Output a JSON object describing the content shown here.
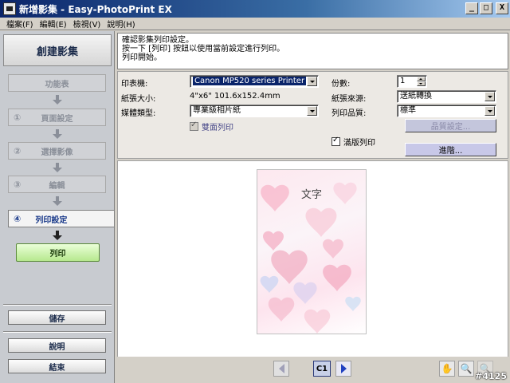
{
  "window": {
    "title": "新增影集 - Easy-PhotoPrint EX",
    "minimize": "_",
    "maximize": "□",
    "close": "X"
  },
  "menu": [
    "檔案(F)",
    "編輯(E)",
    "檢視(V)",
    "說明(H)"
  ],
  "sidebar": {
    "heading": "創建影集",
    "steps": [
      {
        "num": "",
        "label": "功能表"
      },
      {
        "num": "①",
        "label": "頁面設定"
      },
      {
        "num": "②",
        "label": "選擇影像"
      },
      {
        "num": "③",
        "label": "編輯"
      }
    ],
    "active_step": {
      "num": "④",
      "label": "列印設定"
    },
    "print_label": "列印",
    "save_label": "儲存",
    "help_label": "說明",
    "exit_label": "結束"
  },
  "info": {
    "lines": [
      "確認影集列印設定。",
      "按一下 [列印] 按鈕以使用當前設定進行列印。",
      "列印開始。"
    ]
  },
  "settings": {
    "printer_label": "印表機:",
    "printer_value": "Canon MP520 series Printer",
    "paper_size_label": "紙張大小:",
    "paper_size_value": "4\"x6\" 101.6x152.4mm",
    "media_label": "媒體類型:",
    "media_value": "專業級相片紙",
    "duplex_label": "雙面列印",
    "copies_label": "份數:",
    "copies_value": "1",
    "source_label": "紙張來源:",
    "source_value": "送紙轉換",
    "quality_label": "列印品質:",
    "quality_value": "標準",
    "quality_btn": "品質設定...",
    "borderless_label": "滿版列印",
    "advanced_btn": "進階..."
  },
  "preview": {
    "text": "文字",
    "page": "C1"
  },
  "watermark": "#4125"
}
